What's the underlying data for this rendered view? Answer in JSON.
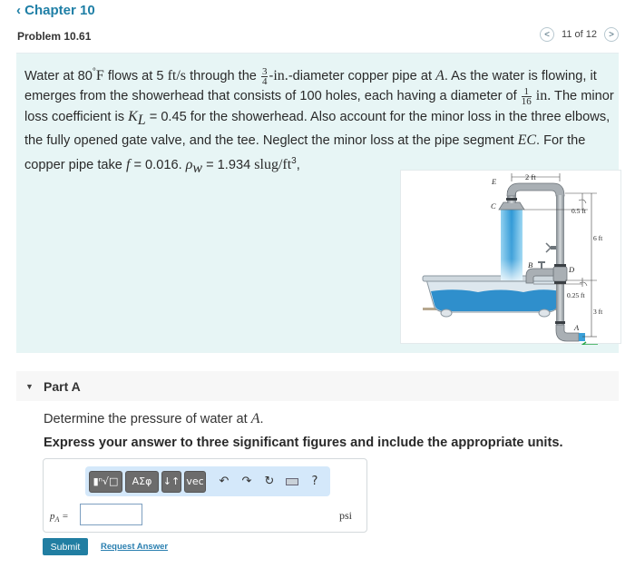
{
  "header": {
    "back_label": "Chapter 10",
    "back_icon": "chevron-left-icon",
    "problem_title": "Problem 10.61",
    "pager": {
      "text": "11 of 12",
      "prev_icon": "chevron-left-icon",
      "next_icon": "chevron-right-icon"
    }
  },
  "problem": {
    "segments": {
      "s1": "Water at 80",
      "deg": "°",
      "F": "F",
      "s2": " flows at 5 ",
      "ftps": "ft/s",
      "s3": " through the ",
      "frac1_num": "3",
      "frac1_den": "4",
      "s4": "-",
      "in1": "in.",
      "s5": "-diameter copper pipe at ",
      "A": "A",
      "s6": ". As the water is flowing, it emerges from the showerhead that consists of 100 holes, each having a diameter of ",
      "frac2_num": "1",
      "frac2_den": "16",
      "in2": " in.",
      "s7": " The minor loss coefficient is ",
      "K": "K",
      "K_sub": "L",
      "s8": " = 0.45 for the showerhead. Also account for the minor loss in the three elbows, the fully opened gate valve, and the tee. Neglect the minor loss at the pipe segment ",
      "EC": "EC",
      "s9": ". For the copper pipe take ",
      "f": "f",
      "s10": " = 0.016. ",
      "rho": "ρ",
      "rho_sub": "w",
      "s11": " = 1.934 ",
      "slug": "slug/ft",
      "cube": "3",
      "s12": ","
    }
  },
  "figure": {
    "labels": {
      "E": "E",
      "C": "C",
      "B": "B",
      "D": "D",
      "A": "A",
      "dim_top": "2 ft",
      "dim_05": "0.5 ft",
      "dim_6": "6 ft",
      "dim_025": "0.25 ft",
      "dim_3": "3 ft"
    },
    "colors": {
      "water": "#3aa0d8",
      "pipe": "#9aa0a6",
      "tub": "#c8d8e4",
      "arrow": "#2aa84a"
    }
  },
  "part": {
    "caret_icon": "caret-down-icon",
    "title": "Part A",
    "question_pre": "Determine the pressure of water at ",
    "question_var": "A",
    "question_post": ".",
    "instruction": "Express your answer to three significant figures and include the appropriate units."
  },
  "answer": {
    "toolbar": {
      "templates_label": "▮ⁿ√□",
      "greek_label": "ΑΣφ",
      "arrows_label": "↓↑",
      "vec_label": "vec",
      "undo_icon": "undo-icon",
      "redo_icon": "redo-icon",
      "reset_icon": "reset-icon",
      "keyboard_icon": "keyboard-icon",
      "help_label": "?"
    },
    "label_var": "p",
    "label_sub": "A",
    "label_eq": " =",
    "input_value": "",
    "unit": "psi"
  },
  "actions": {
    "submit_label": "Submit",
    "request_label": "Request Answer"
  },
  "colors": {
    "accent": "#1f7fa6",
    "problem_bg": "#e7f5f5",
    "toolbar_bg": "#d4e8fa",
    "submit_bg": "#217ea2"
  }
}
